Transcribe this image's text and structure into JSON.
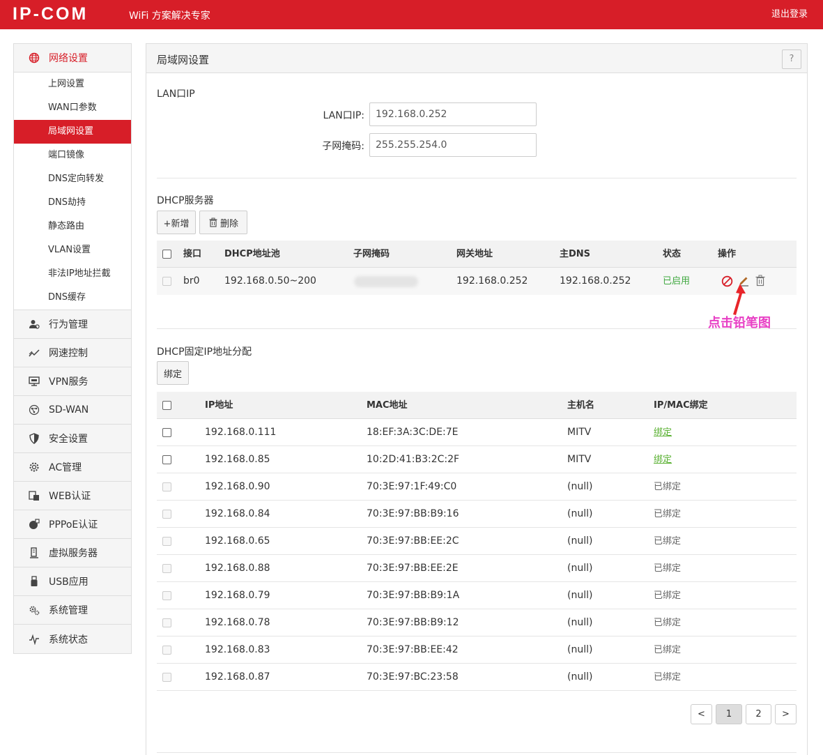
{
  "header": {
    "logo": "IP-COM",
    "slogan": "WiFi 方案解决专家",
    "logout": "退出登录"
  },
  "sidebar": {
    "network_group": "网络设置",
    "network_items": [
      "上网设置",
      "WAN口参数",
      "局域网设置",
      "端口镜像",
      "DNS定向转发",
      "DNS劫持",
      "静态路由",
      "VLAN设置",
      "非法IP地址拦截",
      "DNS缓存"
    ],
    "groups": [
      {
        "label": "行为管理",
        "icon": "user-behavior-icon"
      },
      {
        "label": "网速控制",
        "icon": "speed-chart-icon"
      },
      {
        "label": "VPN服务",
        "icon": "vpn-monitor-icon"
      },
      {
        "label": "SD-WAN",
        "icon": "sdwan-globe-icon"
      },
      {
        "label": "安全设置",
        "icon": "shield-icon"
      },
      {
        "label": "AC管理",
        "icon": "ac-gear-icon"
      },
      {
        "label": "WEB认证",
        "icon": "web-auth-icon"
      },
      {
        "label": "PPPoE认证",
        "icon": "pppoe-globe-icon"
      },
      {
        "label": "虚拟服务器",
        "icon": "server-icon"
      },
      {
        "label": "USB应用",
        "icon": "usb-icon"
      },
      {
        "label": "系统管理",
        "icon": "system-gears-icon"
      },
      {
        "label": "系统状态",
        "icon": "pulse-icon"
      }
    ]
  },
  "panel": {
    "title": "局域网设置",
    "help": "?"
  },
  "lan": {
    "section": "LAN口IP",
    "ip_label": "LAN口IP:",
    "ip_value": "192.168.0.252",
    "mask_label": "子网掩码:",
    "mask_value": "255.255.254.0"
  },
  "dhcp": {
    "section": "DHCP服务器",
    "add_button": "+新增",
    "delete_button": "删除",
    "columns": [
      "接口",
      "DHCP地址池",
      "子网掩码",
      "网关地址",
      "主DNS",
      "状态",
      "操作"
    ],
    "row": {
      "interface": "br0",
      "pool": "192.168.0.50~200",
      "gateway": "192.168.0.252",
      "dns": "192.168.0.252",
      "status": "已启用"
    },
    "annotation": "点击铅笔图"
  },
  "static": {
    "section": "DHCP固定IP地址分配",
    "bind_button": "绑定",
    "columns": [
      "IP地址",
      "MAC地址",
      "主机名",
      "IP/MAC绑定"
    ],
    "rows": [
      {
        "ip": "192.168.0.111",
        "mac": "18:EF:3A:3C:DE:7E",
        "host": "MITV",
        "bind": "绑定"
      },
      {
        "ip": "192.168.0.85",
        "mac": "10:2D:41:B3:2C:2F",
        "host": "MITV",
        "bind": "绑定"
      },
      {
        "ip": "192.168.0.90",
        "mac": "70:3E:97:1F:49:C0",
        "host": "(null)",
        "bind": "已绑定"
      },
      {
        "ip": "192.168.0.84",
        "mac": "70:3E:97:BB:B9:16",
        "host": "(null)",
        "bind": "已绑定"
      },
      {
        "ip": "192.168.0.65",
        "mac": "70:3E:97:BB:EE:2C",
        "host": "(null)",
        "bind": "已绑定"
      },
      {
        "ip": "192.168.0.88",
        "mac": "70:3E:97:BB:EE:2E",
        "host": "(null)",
        "bind": "已绑定"
      },
      {
        "ip": "192.168.0.79",
        "mac": "70:3E:97:BB:B9:1A",
        "host": "(null)",
        "bind": "已绑定"
      },
      {
        "ip": "192.168.0.78",
        "mac": "70:3E:97:BB:B9:12",
        "host": "(null)",
        "bind": "已绑定"
      },
      {
        "ip": "192.168.0.83",
        "mac": "70:3E:97:BB:EE:42",
        "host": "(null)",
        "bind": "已绑定"
      },
      {
        "ip": "192.168.0.87",
        "mac": "70:3E:97:BC:23:58",
        "host": "(null)",
        "bind": "已绑定"
      }
    ]
  },
  "pagination": {
    "prev": "<",
    "page1": "1",
    "page2": "2",
    "next": ">"
  },
  "colors": {
    "brand_red": "#d71e28",
    "status_green": "#3fa83f",
    "annotation_pink": "#e83ec4"
  }
}
